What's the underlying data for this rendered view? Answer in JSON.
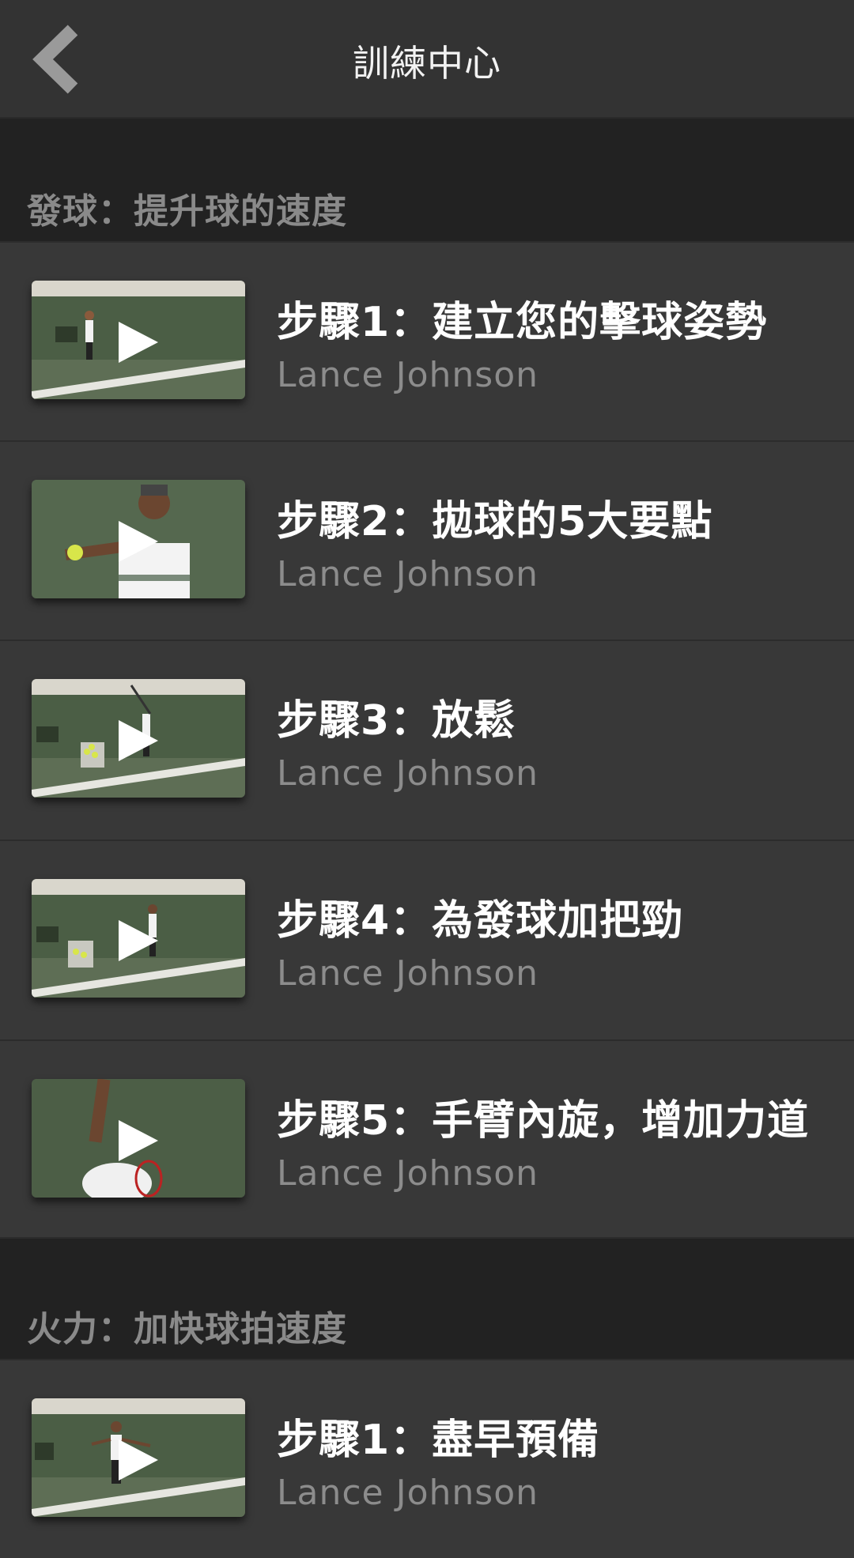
{
  "header": {
    "title": "訓練中心",
    "back_icon": "chevron-left-icon"
  },
  "sections": [
    {
      "title": "發球：提升球的速度",
      "items": [
        {
          "title": "步驟1：建立您的擊球姿勢",
          "author": "Lance Johnson"
        },
        {
          "title": "步驟2：拋球的5大要點",
          "author": "Lance Johnson"
        },
        {
          "title": "步驟3：放鬆",
          "author": "Lance Johnson"
        },
        {
          "title": "步驟4：為發球加把勁",
          "author": "Lance Johnson"
        },
        {
          "title": "步驟5：手臂內旋，增加力道",
          "author": "Lance Johnson"
        }
      ]
    },
    {
      "title": "火力：加快球拍速度",
      "items": [
        {
          "title": "步驟1：盡早預備",
          "author": "Lance Johnson"
        }
      ]
    }
  ],
  "colors": {
    "background": "#222222",
    "row": "#383838",
    "header": "#333333",
    "title_text": "#ffffff",
    "subtitle_text": "#8c8c8c",
    "section_text": "#8a8a8a"
  }
}
